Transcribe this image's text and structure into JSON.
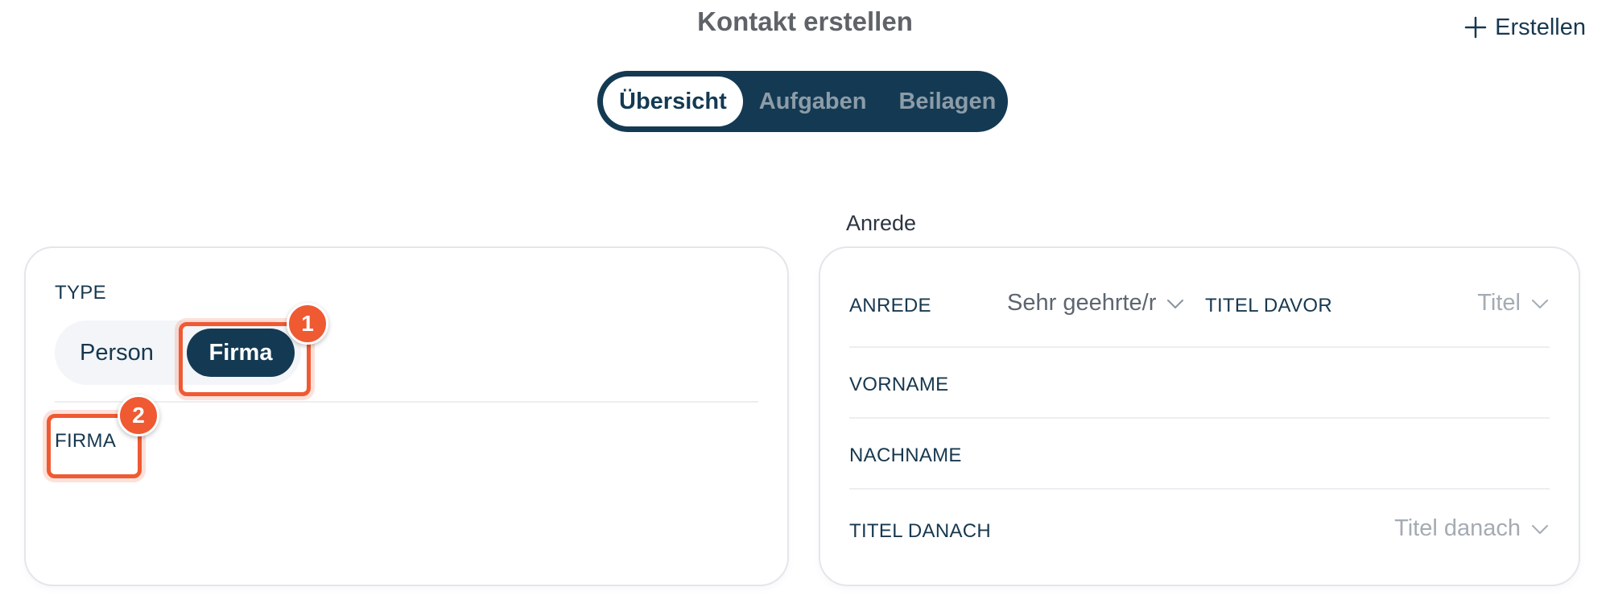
{
  "header": {
    "title": "Kontakt erstellen",
    "create_label": "Erstellen"
  },
  "tabs": [
    {
      "label": "Übersicht",
      "active": true
    },
    {
      "label": "Aufgaben",
      "active": false
    },
    {
      "label": "Beilagen",
      "active": false
    }
  ],
  "section": {
    "anrede_heading": "Anrede"
  },
  "left_card": {
    "type_label": "TYPE",
    "options": [
      "Person",
      "Firma"
    ],
    "selected": "Firma",
    "firma_label": "FIRMA"
  },
  "right_card": {
    "anrede_label": "ANREDE",
    "anrede_value": "Sehr geehrte/r",
    "titel_davor_label": "TITEL DAVOR",
    "titel_davor_placeholder": "Titel",
    "vorname_label": "VORNAME",
    "nachname_label": "NACHNAME",
    "titel_danach_label": "TITEL DANACH",
    "titel_danach_placeholder": "Titel danach"
  },
  "annotations": {
    "step1": "1",
    "step2": "2"
  },
  "colors": {
    "primary": "#143a53",
    "accent": "#ef5a32",
    "muted_text": "#8d9ca8",
    "border": "#e3e6ea"
  },
  "icons": {
    "create": "plus-icon",
    "dropdown": "chevron-down-icon"
  }
}
